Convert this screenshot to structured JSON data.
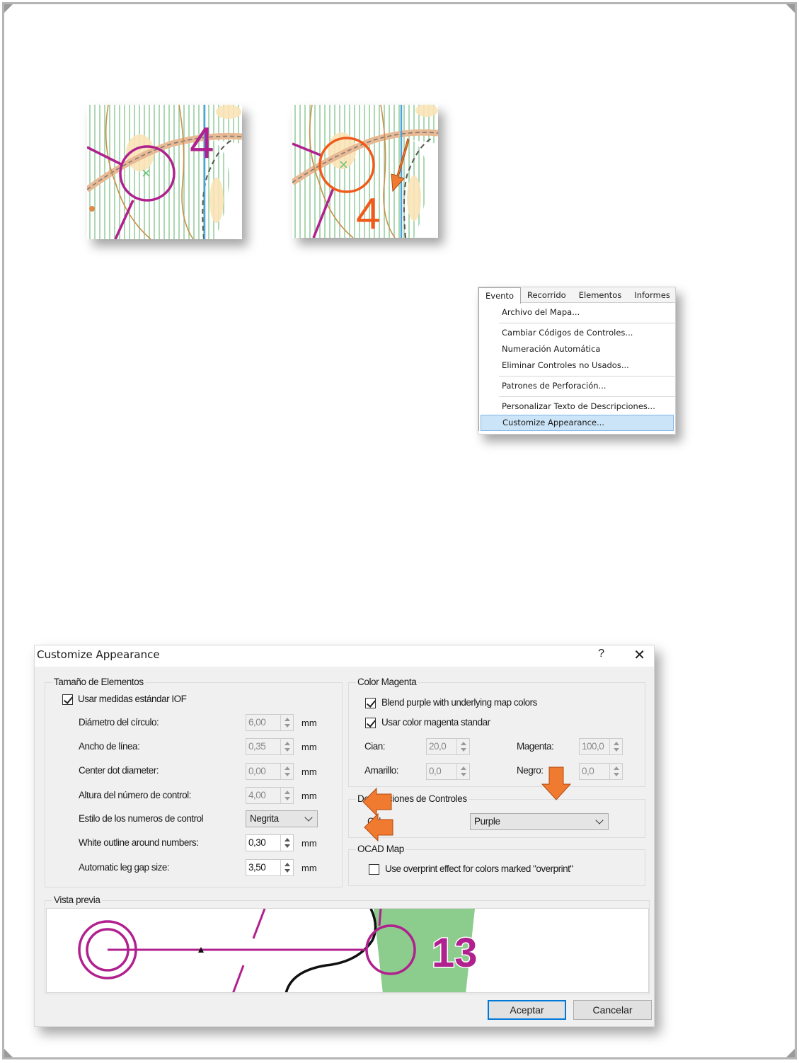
{
  "map_examples": {
    "before_number": "4",
    "after_number": "4"
  },
  "menu": {
    "tabs": [
      "Evento",
      "Recorrido",
      "Elementos",
      "Informes"
    ],
    "items": [
      "Archivo del Mapa...",
      "Cambiar Códigos de Controles...",
      "Numeración Automática",
      "Eliminar Controles no Usados...",
      "Patrones de Perforación...",
      "Personalizar Texto de Descripciones...",
      "Customize Appearance..."
    ],
    "highlighted_item": "Customize Appearance..."
  },
  "dialog": {
    "title": "Customize Appearance",
    "help_label": "?",
    "close_label": "✕",
    "sizes_group": {
      "label": "Tamaño de Elementos",
      "use_iof_label": "Usar medidas estándar IOF",
      "use_iof_checked": true,
      "circle_diameter_label": "Diámetro del círculo:",
      "circle_diameter_value": "6,00",
      "line_width_label": "Ancho de línea:",
      "line_width_value": "0,35",
      "center_dot_label": "Center dot diameter:",
      "center_dot_value": "0,00",
      "number_height_label": "Altura del número de control:",
      "number_height_value": "4,00",
      "number_style_label": "Estilo de los numeros de control",
      "number_style_value": "Negrita",
      "white_outline_label": "White outline around numbers:",
      "white_outline_value": "0,30",
      "leg_gap_label": "Automatic leg gap size:",
      "leg_gap_value": "3,50",
      "unit": "mm"
    },
    "magenta_group": {
      "label": "Color Magenta",
      "blend_label": "Blend purple with underlying map colors",
      "blend_checked": true,
      "standard_label": "Usar color magenta standar",
      "standard_checked": true,
      "cyan_label": "Cian:",
      "cyan_value": "20,0",
      "magenta_label": "Magenta:",
      "magenta_value": "100,0",
      "yellow_label": "Amarillo:",
      "yellow_value": "0,0",
      "black_label": "Negro:",
      "black_value": "0,0"
    },
    "descriptions_group": {
      "label": "Descripciones de Controles",
      "color_label": "Color:",
      "color_value": "Purple"
    },
    "ocad_group": {
      "label": "OCAD Map",
      "overprint_label": "Use overprint effect for colors marked \"overprint\"",
      "overprint_checked": false
    },
    "preview_group": {
      "label": "Vista previa",
      "control_number": "13"
    },
    "ok_label": "Aceptar",
    "cancel_label": "Cancelar"
  },
  "colors": {
    "purple": "#b0208f",
    "orange": "#f05a1a",
    "annotation_arrow": "#f07a30",
    "highlight": "#cce4f7",
    "preview_green": "#8ccc8c"
  }
}
